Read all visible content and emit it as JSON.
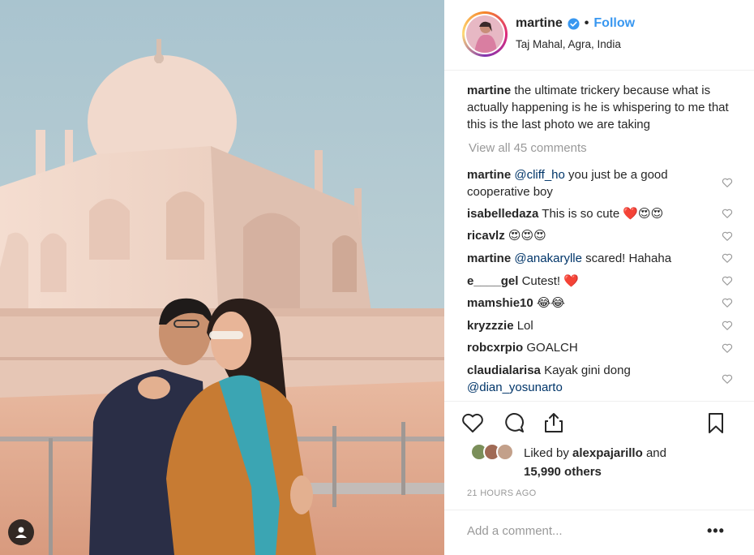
{
  "post": {
    "username": "martine",
    "follow_label": "Follow",
    "separator": "•",
    "location": "Taj Mahal, Agra, India",
    "caption_user": "martine",
    "caption_text": "the ultimate trickery because what is actually happening is he is whispering to me that this is the last photo we are taking",
    "view_all_comments": "View all 45 comments",
    "liked_by_prefix": "Liked by",
    "liked_by_user": "alexpajarillo",
    "liked_by_and": "and",
    "liked_by_others": "15,990 others",
    "timestamp": "21 HOURS AGO",
    "comment_placeholder": "Add a comment...",
    "more_label": "•••"
  },
  "comments": [
    {
      "user": "martine",
      "mention": "@cliff_ho",
      "text": " you just be a good cooperative boy"
    },
    {
      "user": "isabelledaza",
      "mention": "",
      "text": "This is so cute ❤️😍😍"
    },
    {
      "user": "ricavlz",
      "mention": "",
      "text": "😍😍😍"
    },
    {
      "user": "martine",
      "mention": "@anakarylle",
      "text": " scared! Hahaha"
    },
    {
      "user": "e____gel",
      "mention": "",
      "text": "Cutest! ❤️"
    },
    {
      "user": "mamshie10",
      "mention": "",
      "text": "😂😂"
    },
    {
      "user": "kryzzzie",
      "mention": "",
      "text": "Lol"
    },
    {
      "user": "robcxrpio",
      "mention": "",
      "text": "GOALCH"
    },
    {
      "user": "claudialarisa",
      "mention": "",
      "text": "Kayak gini dong",
      "mention_after": "@dian_yosunarto"
    }
  ],
  "icons": {
    "verified": "verified-badge-icon",
    "like": "heart-icon",
    "comment": "comment-bubble-icon",
    "share": "share-icon",
    "save": "bookmark-icon",
    "tag": "user-tag-icon"
  },
  "colors": {
    "link_blue": "#3897f0",
    "mention": "#003569",
    "muted": "#999999",
    "text": "#262626"
  }
}
